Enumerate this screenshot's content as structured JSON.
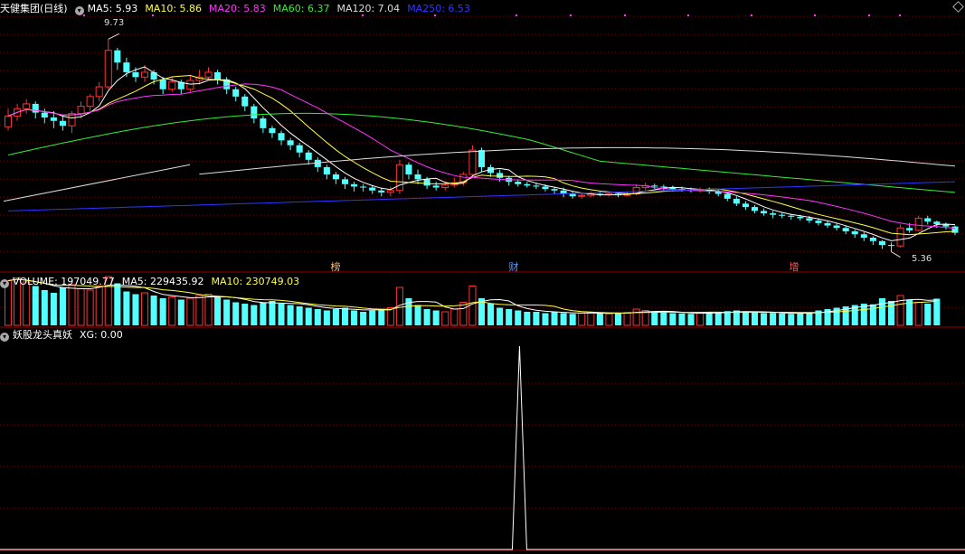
{
  "main": {
    "title": "天健集团(日线)",
    "ma": [
      {
        "label": "MA5: 5.93",
        "color": "#ffffff"
      },
      {
        "label": "MA10: 5.86",
        "color": "#ffff44"
      },
      {
        "label": "MA20: 5.83",
        "color": "#ff33ff"
      },
      {
        "label": "MA60: 6.37",
        "color": "#33ee33"
      },
      {
        "label": "MA120: 7.04",
        "color": "#dddddd"
      },
      {
        "label": "MA250: 6.53",
        "color": "#3333ff"
      }
    ],
    "high_label": "9.73",
    "low_label": "5.36",
    "tags": [
      {
        "text": "榜",
        "color": "#ffbb66"
      },
      {
        "text": "财",
        "color": "#6699ff"
      },
      {
        "text": "增",
        "color": "#ff5555"
      }
    ]
  },
  "volume": {
    "label": "VOLUME: 197049.77",
    "ma5": "MA5: 229435.92",
    "ma10": "MA10: 230749.03"
  },
  "indicator": {
    "name": "妖股龙头真妖",
    "xg": "XG: 0.00"
  },
  "colors": {
    "up": "#ff3333",
    "down": "#54ffff",
    "grid": "#7a0000",
    "border": "#990000"
  },
  "chart_data": [
    {
      "type": "candlestick",
      "title": "天健集团(日线)",
      "ylim": [
        5.0,
        10.2
      ],
      "candles": [
        [
          7.93,
          8.15,
          8.3,
          7.85
        ],
        [
          8.15,
          8.3,
          8.4,
          8.05
        ],
        [
          8.3,
          8.4,
          8.5,
          8.2
        ],
        [
          8.4,
          8.22,
          8.45,
          8.1
        ],
        [
          8.22,
          8.12,
          8.3,
          8.0
        ],
        [
          8.12,
          8.05,
          8.25,
          7.9
        ],
        [
          8.05,
          7.95,
          8.15,
          7.85
        ],
        [
          7.95,
          8.2,
          8.25,
          7.8
        ],
        [
          8.2,
          8.35,
          8.45,
          8.1
        ],
        [
          8.35,
          8.55,
          8.6,
          8.25
        ],
        [
          8.55,
          8.75,
          8.85,
          8.45
        ],
        [
          8.75,
          9.5,
          9.73,
          8.7
        ],
        [
          9.5,
          9.25,
          9.55,
          9.1
        ],
        [
          9.25,
          9.05,
          9.35,
          8.95
        ],
        [
          9.05,
          8.95,
          9.15,
          8.85
        ],
        [
          8.95,
          9.05,
          9.2,
          8.85
        ],
        [
          9.05,
          8.9,
          9.1,
          8.8
        ],
        [
          8.9,
          8.7,
          8.95,
          8.6
        ],
        [
          8.7,
          8.85,
          8.95,
          8.65
        ],
        [
          8.85,
          8.7,
          8.9,
          8.6
        ],
        [
          8.7,
          8.88,
          9.0,
          8.65
        ],
        [
          8.88,
          8.95,
          9.1,
          8.8
        ],
        [
          8.95,
          9.05,
          9.15,
          8.9
        ],
        [
          9.05,
          8.9,
          9.1,
          8.8
        ],
        [
          8.9,
          8.7,
          8.95,
          8.6
        ],
        [
          8.7,
          8.55,
          8.75,
          8.45
        ],
        [
          8.55,
          8.35,
          8.6,
          8.25
        ],
        [
          8.35,
          8.1,
          8.4,
          8.0
        ],
        [
          8.1,
          7.9,
          8.15,
          7.8
        ],
        [
          7.9,
          7.8,
          7.95,
          7.7
        ],
        [
          7.8,
          7.65,
          7.85,
          7.55
        ],
        [
          7.65,
          7.55,
          7.7,
          7.45
        ],
        [
          7.55,
          7.4,
          7.6,
          7.3
        ],
        [
          7.4,
          7.25,
          7.45,
          7.15
        ],
        [
          7.25,
          7.1,
          7.3,
          7.0
        ],
        [
          7.1,
          6.95,
          7.15,
          6.85
        ],
        [
          6.95,
          6.85,
          7.0,
          6.75
        ],
        [
          6.85,
          6.75,
          6.9,
          6.65
        ],
        [
          6.75,
          6.7,
          6.8,
          6.6
        ],
        [
          6.7,
          6.68,
          6.75,
          6.6
        ],
        [
          6.68,
          6.62,
          6.72,
          6.55
        ],
        [
          6.62,
          6.58,
          6.68,
          6.5
        ],
        [
          6.58,
          6.62,
          6.7,
          6.5
        ],
        [
          6.62,
          7.15,
          7.25,
          6.55
        ],
        [
          7.15,
          6.95,
          7.2,
          6.85
        ],
        [
          6.95,
          6.85,
          7.05,
          6.75
        ],
        [
          6.85,
          6.72,
          6.9,
          6.65
        ],
        [
          6.72,
          6.68,
          6.8,
          6.62
        ],
        [
          6.68,
          6.73,
          6.8,
          6.62
        ],
        [
          6.73,
          6.78,
          6.88,
          6.68
        ],
        [
          6.78,
          6.95,
          7.0,
          6.72
        ],
        [
          6.95,
          7.45,
          7.55,
          6.9
        ],
        [
          7.45,
          7.1,
          7.5,
          7.0
        ],
        [
          7.1,
          6.98,
          7.15,
          6.9
        ],
        [
          6.98,
          6.88,
          7.05,
          6.8
        ],
        [
          6.88,
          6.8,
          6.92,
          6.72
        ],
        [
          6.8,
          6.75,
          6.85,
          6.7
        ],
        [
          6.75,
          6.72,
          6.8,
          6.68
        ],
        [
          6.72,
          6.7,
          6.78,
          6.65
        ],
        [
          6.7,
          6.65,
          6.75,
          6.6
        ],
        [
          6.65,
          6.62,
          6.7,
          6.55
        ],
        [
          6.62,
          6.55,
          6.68,
          6.48
        ],
        [
          6.55,
          6.5,
          6.6,
          6.45
        ],
        [
          6.5,
          6.52,
          6.58,
          6.45
        ],
        [
          6.52,
          6.55,
          6.6,
          6.48
        ],
        [
          6.55,
          6.53,
          6.6,
          6.5
        ],
        [
          6.53,
          6.55,
          6.58,
          6.5
        ],
        [
          6.55,
          6.52,
          6.58,
          6.48
        ],
        [
          6.52,
          6.55,
          6.6,
          6.5
        ],
        [
          6.55,
          6.68,
          6.75,
          6.52
        ],
        [
          6.68,
          6.72,
          6.78,
          6.62
        ],
        [
          6.72,
          6.7,
          6.76,
          6.65
        ],
        [
          6.7,
          6.68,
          6.74,
          6.62
        ],
        [
          6.68,
          6.65,
          6.72,
          6.6
        ],
        [
          6.65,
          6.63,
          6.7,
          6.6
        ],
        [
          6.63,
          6.62,
          6.68,
          6.58
        ],
        [
          6.62,
          6.64,
          6.68,
          6.58
        ],
        [
          6.64,
          6.6,
          6.68,
          6.55
        ],
        [
          6.6,
          6.55,
          6.64,
          6.5
        ],
        [
          6.55,
          6.45,
          6.58,
          6.4
        ],
        [
          6.45,
          6.35,
          6.5,
          6.3
        ],
        [
          6.35,
          6.28,
          6.4,
          6.22
        ],
        [
          6.28,
          6.2,
          6.32,
          6.15
        ],
        [
          6.2,
          6.15,
          6.25,
          6.1
        ],
        [
          6.15,
          6.12,
          6.2,
          6.05
        ],
        [
          6.12,
          6.1,
          6.16,
          6.05
        ],
        [
          6.1,
          6.08,
          6.14,
          6.02
        ],
        [
          6.08,
          6.05,
          6.12,
          6.0
        ],
        [
          6.05,
          6.0,
          6.1,
          5.95
        ],
        [
          6.0,
          5.95,
          6.05,
          5.9
        ],
        [
          5.95,
          5.9,
          6.0,
          5.85
        ],
        [
          5.9,
          5.85,
          5.95,
          5.8
        ],
        [
          5.85,
          5.78,
          5.9,
          5.72
        ],
        [
          5.78,
          5.72,
          5.82,
          5.65
        ],
        [
          5.72,
          5.65,
          5.76,
          5.58
        ],
        [
          5.65,
          5.58,
          5.68,
          5.5
        ],
        [
          5.58,
          5.5,
          5.6,
          5.42
        ],
        [
          5.5,
          5.48,
          5.55,
          5.36
        ],
        [
          5.48,
          5.85,
          5.92,
          5.45
        ],
        [
          5.85,
          5.8,
          5.95,
          5.75
        ],
        [
          5.8,
          6.05,
          6.1,
          5.78
        ],
        [
          6.05,
          5.98,
          6.1,
          5.92
        ],
        [
          5.98,
          5.93,
          6.0,
          5.85
        ],
        [
          5.93,
          5.88,
          5.96,
          5.82
        ],
        [
          5.88,
          5.75,
          5.9,
          5.7
        ]
      ],
      "ma_values": {
        "MA5": 5.93,
        "MA10": 5.86,
        "MA20": 5.83,
        "MA60": 6.37,
        "MA120": 7.04,
        "MA250": 6.53
      },
      "high": 9.73,
      "low": 5.36
    },
    {
      "type": "bar",
      "title": "VOLUME",
      "ylim": [
        0,
        400000
      ],
      "values": [
        330000,
        350000,
        320000,
        290000,
        260000,
        240000,
        280000,
        300000,
        270000,
        260000,
        290000,
        360000,
        310000,
        250000,
        230000,
        240000,
        220000,
        200000,
        210000,
        190000,
        200000,
        220000,
        230000,
        210000,
        190000,
        170000,
        160000,
        150000,
        170000,
        180000,
        160000,
        150000,
        140000,
        130000,
        120000,
        110000,
        120000,
        130000,
        110000,
        100000,
        110000,
        120000,
        130000,
        280000,
        200000,
        150000,
        120000,
        110000,
        100000,
        120000,
        170000,
        290000,
        200000,
        160000,
        130000,
        120000,
        110000,
        100000,
        100000,
        90000,
        100000,
        90000,
        85000,
        90000,
        95000,
        90000,
        85000,
        90000,
        95000,
        120000,
        110000,
        100000,
        95000,
        90000,
        88000,
        85000,
        90000,
        100000,
        95000,
        105000,
        110000,
        100000,
        95000,
        90000,
        92000,
        88000,
        85000,
        90000,
        95000,
        110000,
        120000,
        130000,
        140000,
        150000,
        160000,
        155000,
        200000,
        180000,
        220000,
        190000,
        170000,
        160000,
        197049.77
      ],
      "ma5": 229435.92,
      "ma10": 230749.03
    },
    {
      "type": "line",
      "title": "妖股龙头真妖",
      "ylim": [
        0,
        1
      ],
      "spike_index": 51,
      "xg": 0.0
    }
  ]
}
